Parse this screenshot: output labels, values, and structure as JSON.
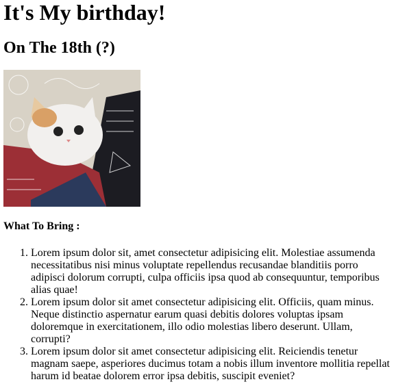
{
  "title": "It's My birthday!",
  "subtitle": "On The 18th (?)",
  "image": {
    "alt": "cat with math equations"
  },
  "bring_heading": "What To Bring :",
  "items": [
    "Lorem ipsum dolor sit, amet consectetur adipisicing elit. Molestiae assumenda necessitatibus nisi minus voluptate repellendus recusandae blanditiis porro adipisci dolorum corrupti, culpa officiis ipsa quod ab consequuntur, temporibus alias quae!",
    "Lorem ipsum dolor sit amet consectetur adipisicing elit. Officiis, quam minus. Neque distinctio aspernatur earum quasi debitis dolores voluptas ipsam doloremque in exercitationem, illo odio molestias libero deserunt. Ullam, corrupti?",
    "Lorem ipsum dolor sit amet consectetur adipisicing elit. Reiciendis tenetur magnam saepe, asperiores ducimus totam a nobis illum inventore mollitia repellat harum id beatae dolorem error ipsa debitis, suscipit eveniet?"
  ]
}
